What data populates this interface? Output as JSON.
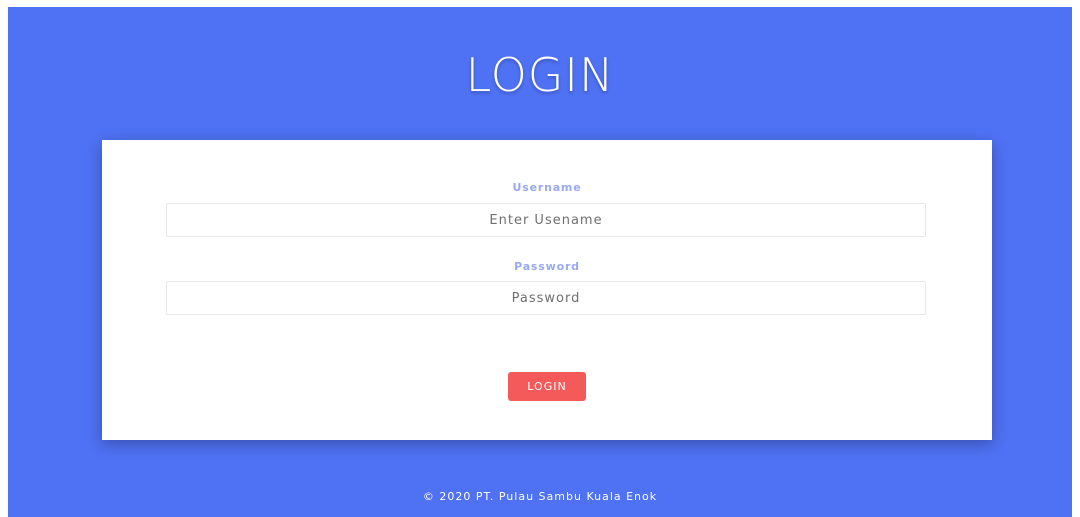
{
  "header": {
    "title": "LOGIN"
  },
  "form": {
    "username": {
      "label": "Username",
      "placeholder": "Enter Usename",
      "value": ""
    },
    "password": {
      "label": "Password",
      "placeholder": "Password",
      "value": ""
    },
    "submit_label": "LOGIN"
  },
  "footer": {
    "text": "© 2020 PT. Pulau Sambu Kuala Enok"
  },
  "colors": {
    "background": "#4f71f3",
    "card": "#ffffff",
    "label": "#9aa9ee",
    "button": "#f55a5a"
  }
}
